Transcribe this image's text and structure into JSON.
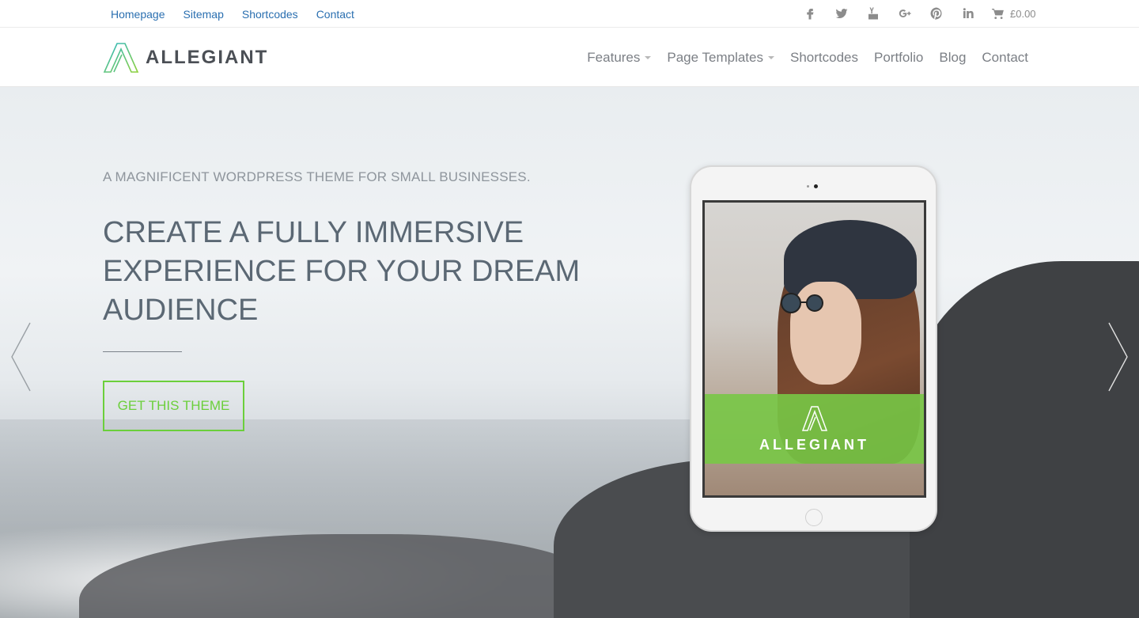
{
  "topnav": {
    "items": [
      "Homepage",
      "Sitemap",
      "Shortcodes",
      "Contact"
    ]
  },
  "social": [
    "facebook-icon",
    "twitter-icon",
    "youtube-icon",
    "google-plus-icon",
    "pinterest-icon",
    "linkedin-icon"
  ],
  "cart": {
    "amount": "£0.00"
  },
  "logo": {
    "text": "ALLEGIANT"
  },
  "mainnav": {
    "features": "Features",
    "page_templates": "Page Templates",
    "shortcodes": "Shortcodes",
    "portfolio": "Portfolio",
    "blog": "Blog",
    "contact": "Contact"
  },
  "hero": {
    "eyebrow": "A MAGNIFICENT WORDPRESS THEME FOR SMALL BUSINESSES.",
    "headline": "CREATE A FULLY IMMERSIVE EXPERIENCE FOR YOUR DREAM AUDIENCE",
    "cta": "GET THIS THEME"
  },
  "tablet": {
    "banner_text": "ALLEGIANT"
  },
  "colors": {
    "link": "#2a6fb0",
    "accent_green": "#6bcf3b",
    "headline": "#5b6874"
  }
}
